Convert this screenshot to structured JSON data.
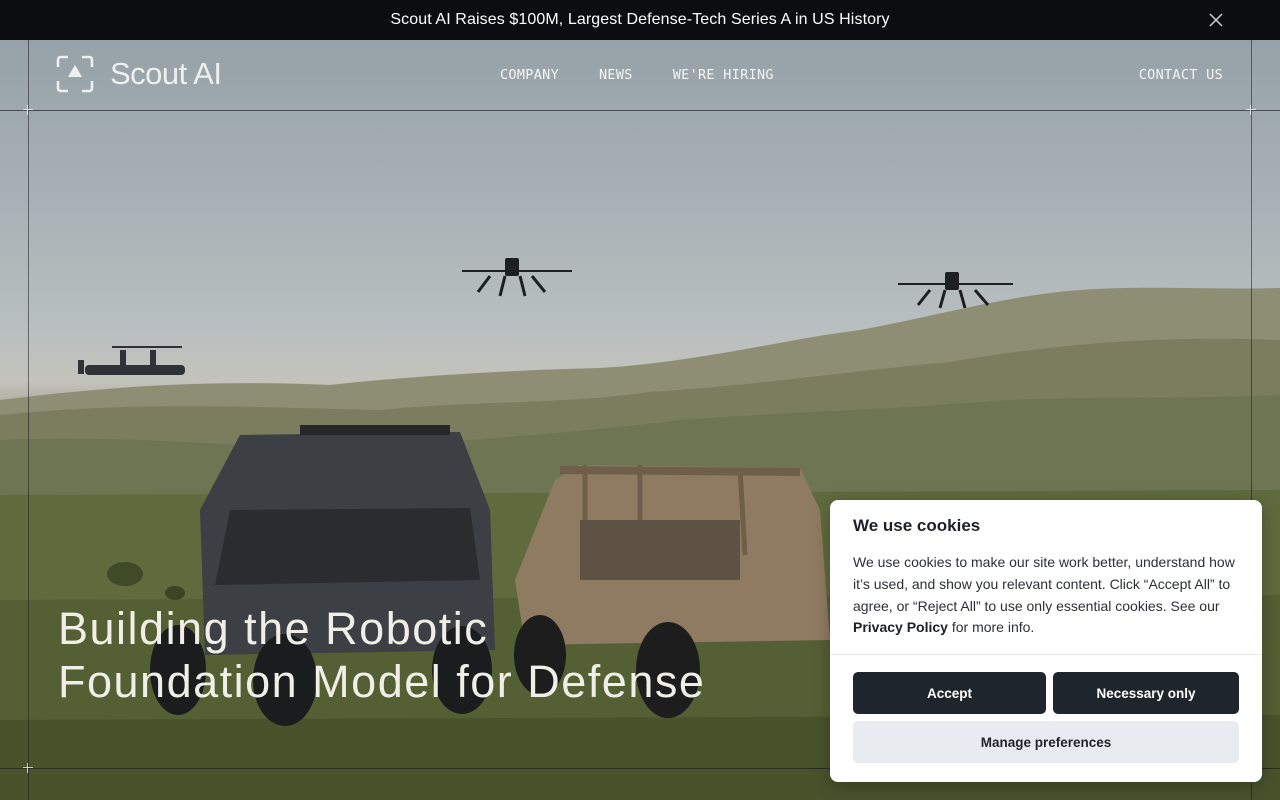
{
  "announcement": {
    "text": "Scout AI Raises $100M, Largest Defense-Tech Series A in US History",
    "close_icon": "close-icon"
  },
  "nav": {
    "logo_text": "Scout AI",
    "logo_icon": "scout-logo-icon",
    "links": [
      {
        "label": "COMPANY"
      },
      {
        "label": "NEWS"
      },
      {
        "label": "WE'RE HIRING"
      }
    ],
    "contact_label": "CONTACT US"
  },
  "hero": {
    "headline_line1": "Building the Robotic",
    "headline_line2": "Foundation Model for Defense"
  },
  "cookie_banner": {
    "title": "We use cookies",
    "body_before": "We use cookies to make our site work better, understand how it’s used, and show you relevant content. Click “Accept All” to agree, or “Reject All” to use only essential cookies. See our ",
    "link_label": "Privacy Policy",
    "body_after": " for more info.",
    "accept_label": "Accept",
    "necessary_label": "Necessary only",
    "manage_label": "Manage preferences"
  },
  "colors": {
    "announcement_bg": "#0c0d10",
    "button_dark": "#1f252d",
    "button_light": "#e8ebef"
  }
}
